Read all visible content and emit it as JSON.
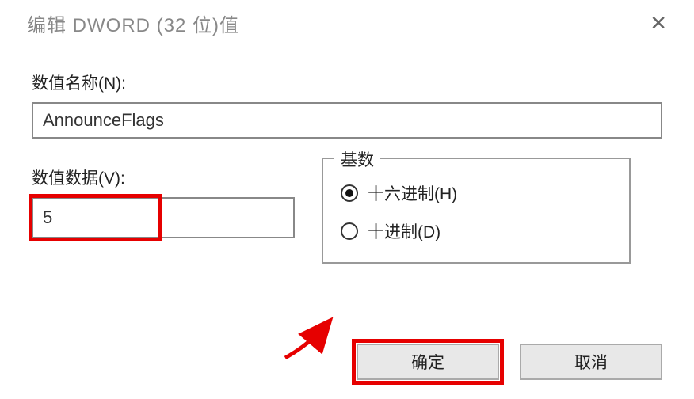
{
  "title": "编辑 DWORD (32 位)值",
  "name_label": "数值名称(N):",
  "name_value": "AnnounceFlags",
  "data_label": "数值数据(V):",
  "data_value": "5",
  "base": {
    "legend": "基数",
    "hex": "十六进制(H)",
    "dec": "十进制(D)",
    "selected": "hex"
  },
  "buttons": {
    "ok": "确定",
    "cancel": "取消"
  },
  "highlights": {
    "color": "#e60000"
  }
}
